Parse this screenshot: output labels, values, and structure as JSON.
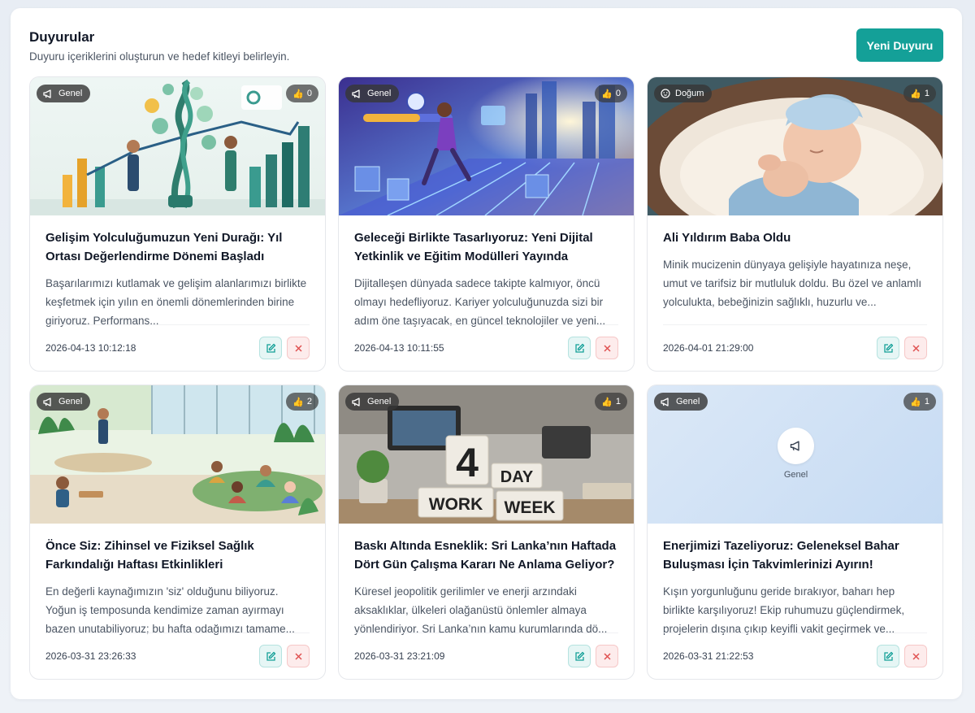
{
  "header": {
    "title": "Duyurular",
    "subtitle": "Duyuru içeriklerini oluşturun ve hedef kitleyi belirleyin.",
    "new_button": "Yeni Duyuru"
  },
  "colors": {
    "accent": "#14a098",
    "delete": "#e05252",
    "badge_bg": "#3a3a3a"
  },
  "cards": [
    {
      "category": "Genel",
      "category_icon": "megaphone-icon",
      "likes": "0",
      "title": "Gelişim Yolculuğumuzun Yeni Durağı: Yıl Ortası Değerlendirme Dönemi Başladı",
      "description": "Başarılarımızı kutlamak ve gelişim alanlarımızı birlikte keşfetmek için yılın en önemli dönemlerinden birine giriyoruz. Performans...",
      "date": "2026-04-13 10:12:18"
    },
    {
      "category": "Genel",
      "category_icon": "megaphone-icon",
      "likes": "0",
      "title": "Geleceği Birlikte Tasarlıyoruz: Yeni Dijital Yetkinlik ve Eğitim Modülleri Yayında",
      "description": "Dijitalleşen dünyada sadece takipte kalmıyor, öncü olmayı hedefliyoruz. Kariyer yolculuğunuzda sizi bir adım öne taşıyacak, en güncel teknolojiler ve yeni...",
      "date": "2026-04-13 10:11:55"
    },
    {
      "category": "Doğum",
      "category_icon": "baby-face-icon",
      "likes": "1",
      "title": "Ali Yıldırım Baba Oldu",
      "description": "Minik mucizenin dünyaya gelişiyle hayatınıza neşe, umut ve tarifsiz bir mutluluk doldu. Bu özel ve anlamlı yolculukta, bebeğinizin sağlıklı, huzurlu ve...",
      "date": "2026-04-01 21:29:00"
    },
    {
      "category": "Genel",
      "category_icon": "megaphone-icon",
      "likes": "2",
      "title": "Önce Siz: Zihinsel ve Fiziksel Sağlık Farkındalığı Haftası Etkinlikleri",
      "description": "En değerli kaynağımızın 'siz' olduğunu biliyoruz. Yoğun iş temposunda kendimize zaman ayırmayı bazen unutabiliyoruz; bu hafta odağımızı tamame...",
      "date": "2026-03-31 23:26:33"
    },
    {
      "category": "Genel",
      "category_icon": "megaphone-icon",
      "likes": "1",
      "title": "Baskı Altında Esneklik: Sri Lanka’nın Haftada Dört Gün Çalışma Kararı Ne Anlama Geliyor?",
      "description": "Küresel jeopolitik gerilimler ve enerji arzındaki aksaklıklar, ülkeleri olağanüstü önlemler almaya yönlendiriyor. Sri Lanka’nın kamu kurumlarında dö...",
      "date": "2026-03-31 23:21:09",
      "image_text": {
        "n": "4",
        "day": "DAY",
        "work": "WORK",
        "week": "WEEK"
      }
    },
    {
      "category": "Genel",
      "category_icon": "megaphone-icon",
      "likes": "1",
      "title": "Enerjimizi Tazeliyoruz: Geleneksel Bahar Buluşması İçin Takvimlerinizi Ayırın!",
      "description": "Kışın yorgunluğunu geride bırakıyor, baharı hep birlikte karşılıyoruz! Ekip ruhumuzu güçlendirmek, projelerin dışına çıkıp keyifli vakit geçirmek ve...",
      "date": "2026-03-31 21:22:53",
      "placeholder_label": "Genel"
    }
  ]
}
